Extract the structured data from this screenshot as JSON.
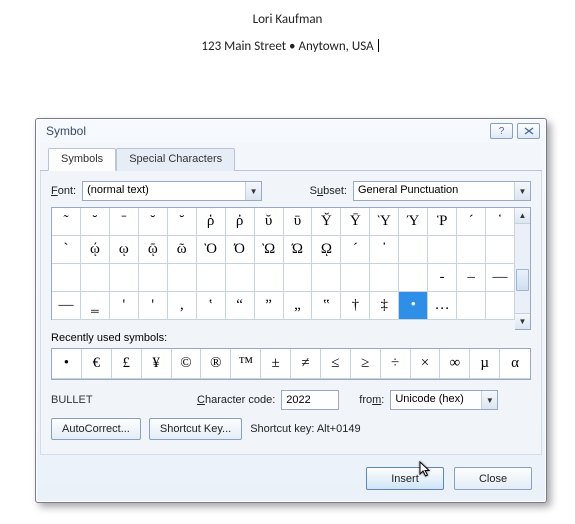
{
  "document": {
    "name": "Lori Kaufman",
    "address": "123 Main Street • Anytown, USA"
  },
  "dialog": {
    "title": "Symbol",
    "tabs": [
      {
        "label": "Symbols",
        "ukey": "S"
      },
      {
        "label": "Special Characters",
        "ukey": "P"
      }
    ],
    "font_label": "Font:",
    "font_value": "(normal text)",
    "subset_label": "Subset:",
    "subset_value": "General Punctuation",
    "grid": [
      [
        "˜",
        "˘",
        "ˉ",
        "˘",
        "˘",
        "ῥ",
        "ῤ",
        "ῠ",
        "ῡ",
        "Ῠ",
        "Ῡ",
        "Ὺ",
        "Ύ",
        "Ῥ",
        "´",
        "῾"
      ],
      [
        "`",
        "ῴ",
        "ῳ",
        "ῷ",
        "ῶ",
        "Ὸ",
        "Ό",
        "Ὼ",
        "Ώ",
        "ῼ",
        "´",
        "᾽",
        " ",
        " ",
        " ",
        " "
      ],
      [
        " ",
        " ",
        " ",
        " ",
        " ",
        " ",
        " ",
        " ",
        " ",
        " ",
        " ",
        " ",
        " ",
        "‐",
        "–",
        "—"
      ],
      [
        "―",
        "‗",
        "'",
        "'",
        "‚",
        "‛",
        "“",
        "”",
        "„",
        "‟",
        "†",
        "‡",
        "•",
        "…",
        " ",
        " "
      ]
    ],
    "selected": {
      "row": 3,
      "col": 12
    },
    "recent_label": "Recently used symbols:",
    "recent": [
      "•",
      "€",
      "£",
      "¥",
      "©",
      "®",
      "™",
      "±",
      "≠",
      "≤",
      "≥",
      "÷",
      "×",
      "∞",
      "µ",
      "α"
    ],
    "char_name": "BULLET",
    "code_label": "Character code:",
    "code_value": "2022",
    "from_label": "from:",
    "from_value": "Unicode (hex)",
    "autocorrect_label": "AutoCorrect...",
    "shortcutkey_label": "Shortcut Key...",
    "shortcut_text_label": "Shortcut key:",
    "shortcut_text_value": "Alt+0149",
    "insert_label": "Insert",
    "close_label": "Close"
  }
}
